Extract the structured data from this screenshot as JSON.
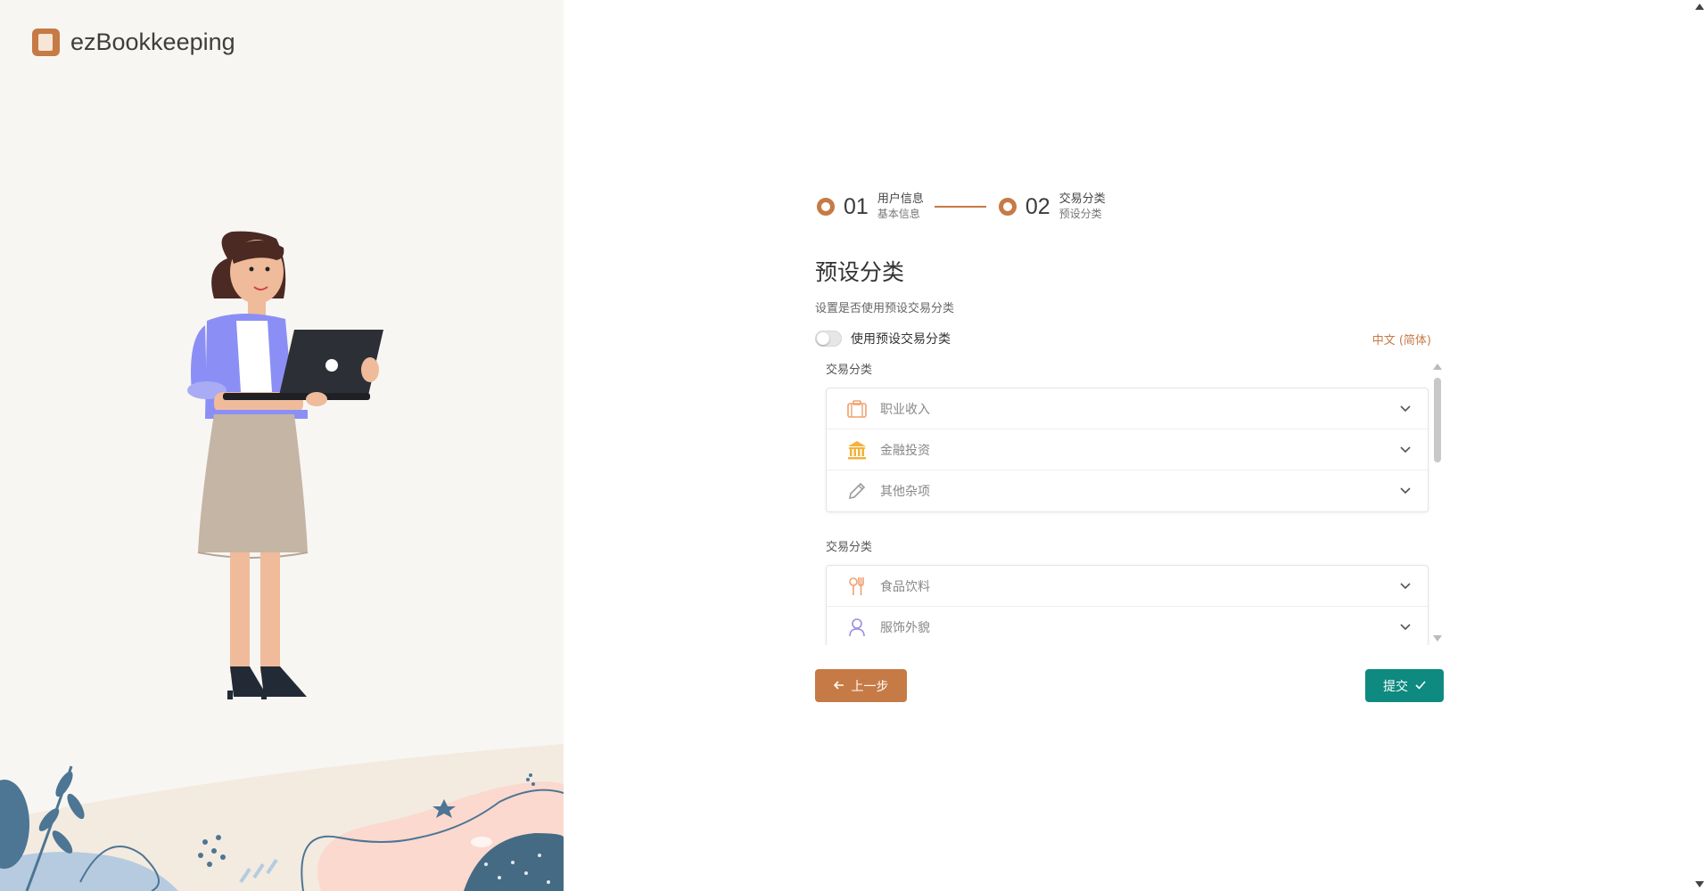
{
  "app": {
    "name": "ezBookkeeping"
  },
  "stepper": {
    "steps": [
      {
        "number": "01",
        "title": "用户信息",
        "subtitle": "基本信息"
      },
      {
        "number": "02",
        "title": "交易分类",
        "subtitle": "预设分类"
      }
    ]
  },
  "page": {
    "title": "预设分类",
    "description": "设置是否使用预设交易分类"
  },
  "toggle": {
    "label": "使用预设交易分类",
    "checked": false
  },
  "language_link": "中文 (简体)",
  "category_groups": [
    {
      "title": "交易分类",
      "items": [
        {
          "name": "职业收入",
          "icon": "briefcase-icon",
          "color": "#f0a070"
        },
        {
          "name": "金融投资",
          "icon": "bank-icon",
          "color": "#f2b23c"
        },
        {
          "name": "其他杂项",
          "icon": "pencil-icon",
          "color": "#9a9a9a"
        }
      ]
    },
    {
      "title": "交易分类",
      "items": [
        {
          "name": "食品饮料",
          "icon": "utensils-icon",
          "color": "#f0a070"
        },
        {
          "name": "服饰外貌",
          "icon": "person-icon",
          "color": "#9b8ee0"
        }
      ]
    }
  ],
  "buttons": {
    "prev_label": "上一步",
    "submit_label": "提交"
  },
  "colors": {
    "accent": "#c67a45",
    "submit": "#0e8a80"
  }
}
